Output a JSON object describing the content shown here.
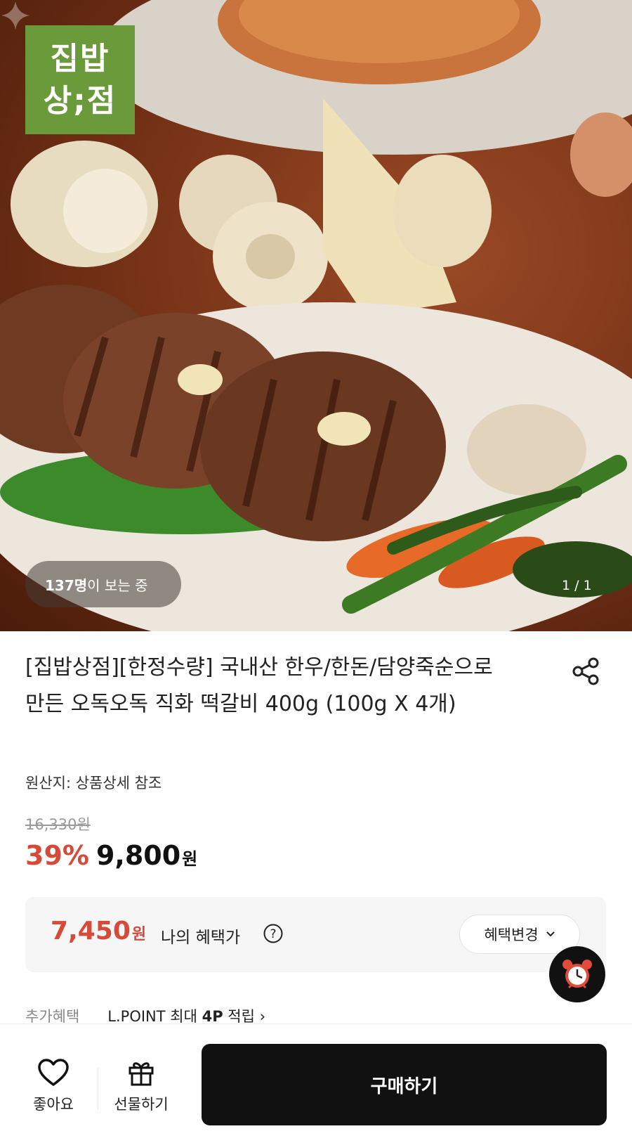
{
  "brand": {
    "logo_line1": "집밥",
    "logo_line2": "상;점"
  },
  "hero": {
    "viewers_count": "137명",
    "viewers_suffix": "이 보는 중",
    "page_indicator": "1 / 1"
  },
  "product": {
    "title": "[집밥상점][한정수량] 국내산 한우/한돈/담양죽순으로 만든 오독오독 직화 떡갈비 400g (100g X 4개)",
    "origin": "원산지: 상품상세 참조",
    "original_price": "16,330원",
    "discount": "39%",
    "price": "9,800",
    "currency": "원"
  },
  "benefit": {
    "price": "7,450",
    "currency": "원",
    "label": "나의 혜택가",
    "change_label": "혜택변경"
  },
  "extra": {
    "label": "추가혜택",
    "lpoint_prefix": "L.POINT 최대 ",
    "lpoint_amount": "4P",
    "lpoint_suffix": " 적립 ›"
  },
  "bottom_bar": {
    "like_label": "좋아요",
    "gift_label": "선물하기",
    "buy_label": "구매하기"
  },
  "colors": {
    "accent_red": "#d64a3a",
    "brand_green": "#6a9a3a",
    "buy_black": "#111111"
  }
}
